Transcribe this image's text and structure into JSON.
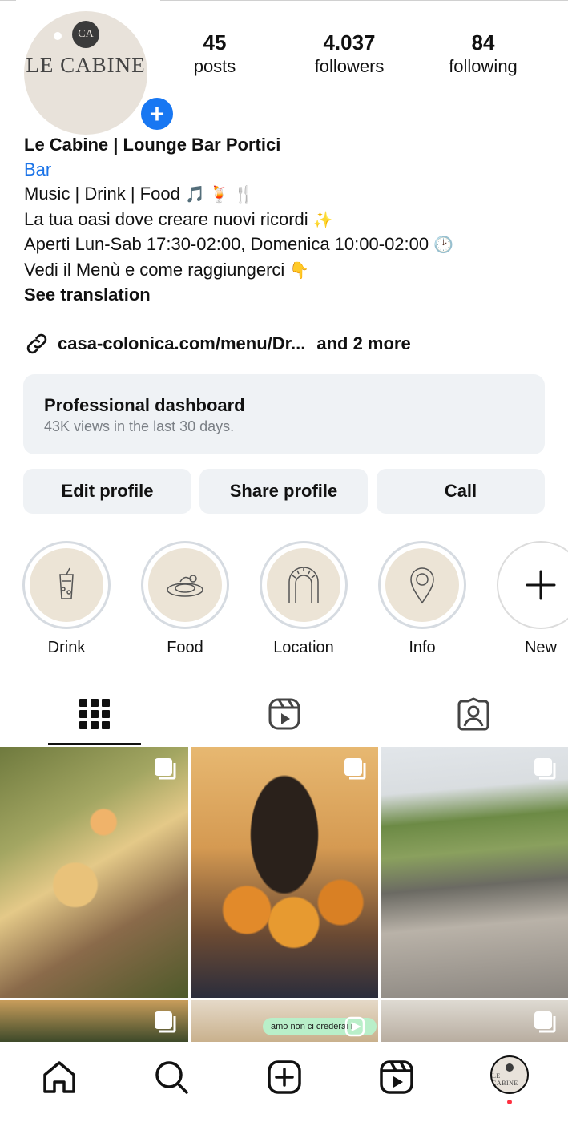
{
  "profile": {
    "avatar_badge": "CA",
    "avatar_name": "LE CABINE",
    "add_story_symbol": "+",
    "stats": {
      "posts": {
        "value": "45",
        "label": "posts"
      },
      "followers": {
        "value": "4.037",
        "label": "followers"
      },
      "following": {
        "value": "84",
        "label": "following"
      }
    }
  },
  "bio": {
    "name": "Le Cabine | Lounge Bar Portici",
    "category": "Bar",
    "line1": "Music | Drink | Food",
    "line1_emoji": "🎵 🍹 🍴",
    "line2": "La tua oasi dove creare nuovi ricordi",
    "line2_emoji": "✨",
    "line3": "Aperti Lun-Sab 17:30-02:00, Domenica 10:00-02:00",
    "line3_emoji": "🕑",
    "line4": "Vedi il Menù e come raggiungerci",
    "line4_emoji": "👇",
    "see_translation": "See translation"
  },
  "links": {
    "icon": "link-icon",
    "url": "casa-colonica.com/menu/Dr...",
    "more": "and 2 more"
  },
  "dashboard": {
    "title": "Professional dashboard",
    "subtitle": "43K views in the last 30 days."
  },
  "buttons": {
    "edit": "Edit profile",
    "share": "Share profile",
    "call": "Call"
  },
  "highlights": [
    {
      "label": "Drink",
      "icon": "cocktail-icon"
    },
    {
      "label": "Food",
      "icon": "food-plate-icon"
    },
    {
      "label": "Location",
      "icon": "arch-icon"
    },
    {
      "label": "Info",
      "icon": "location-pin-icon"
    },
    {
      "label": "New",
      "icon": "plus-icon"
    }
  ],
  "tabs": [
    {
      "name": "grid",
      "icon": "grid-icon",
      "active": true
    },
    {
      "name": "reels",
      "icon": "reels-icon",
      "active": false
    },
    {
      "name": "tagged",
      "icon": "tagged-icon",
      "active": false
    }
  ],
  "grid": {
    "reel_caption": "amo non ci crederai i"
  },
  "bottom_nav": {
    "items": [
      "home-icon",
      "search-icon",
      "create-icon",
      "reels-icon",
      "profile-avatar"
    ],
    "avatar_name": "LE CABINE"
  },
  "colors": {
    "accent_blue": "#1877f2",
    "link_blue": "#1a73e8",
    "button_bg": "#eff2f5",
    "notification": "#ff3040"
  }
}
